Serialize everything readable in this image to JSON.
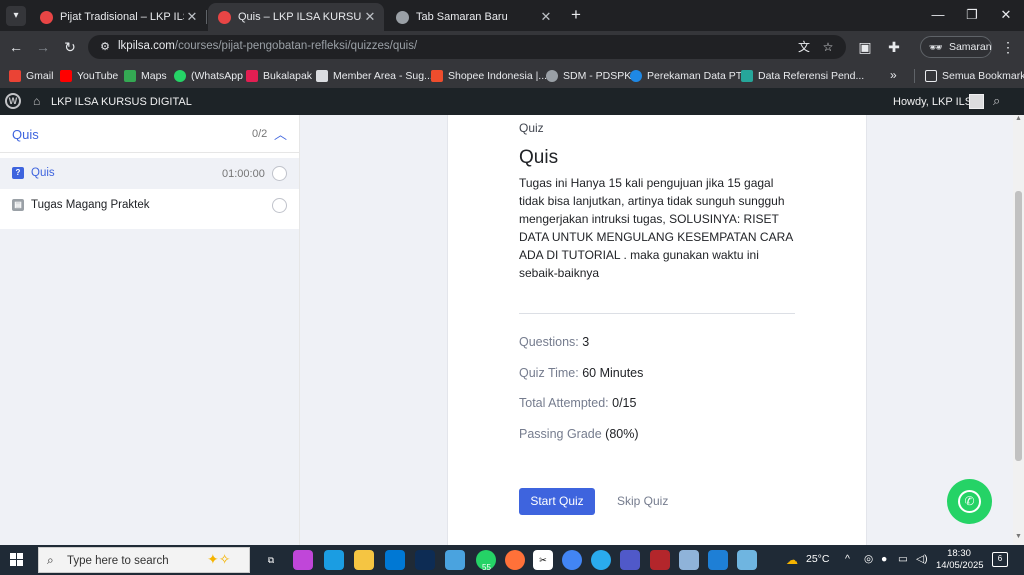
{
  "browser": {
    "tabs": [
      {
        "title": "Pijat Tradisional – LKP ILSA KURSUS",
        "favicon_color": "#e84545",
        "active": false
      },
      {
        "title": "Quis – LKP ILSA KURSUS DIGITAL",
        "favicon_color": "#e84545",
        "active": true
      },
      {
        "title": "Tab Samaran Baru",
        "favicon_color": "#9aa0a6",
        "active": false
      }
    ],
    "url_host": "lkpilsa.com",
    "url_path": "/courses/pijat-pengobatan-refleksi/quizzes/quis/",
    "profile_label": "Samaran",
    "bookmarks": [
      {
        "label": "Gmail",
        "icon": "gmail-icon",
        "color": "#ea4335"
      },
      {
        "label": "YouTube",
        "icon": "youtube-icon",
        "color": "#ff0000"
      },
      {
        "label": "Maps",
        "icon": "maps-icon",
        "color": "#34a853"
      },
      {
        "label": "(WhatsApp",
        "icon": "whatsapp-icon",
        "color": "#25d366"
      },
      {
        "label": "Bukalapak",
        "icon": "bukalapak-icon",
        "color": "#e31e52"
      },
      {
        "label": "Member Area - Sug...",
        "icon": "member-area-icon",
        "color": "#dadce0"
      },
      {
        "label": "Shopee Indonesia |...",
        "icon": "shopee-icon",
        "color": "#ee4d2d"
      },
      {
        "label": "SDM - PDSPK",
        "icon": "globe-icon",
        "color": "#9aa0a6"
      },
      {
        "label": "Perekaman Data PTK",
        "icon": "ptk-icon",
        "color": "#1e88e5"
      },
      {
        "label": "Data Referensi Pend...",
        "icon": "data-ref-icon",
        "color": "#26a69a"
      }
    ],
    "all_bookmarks_label": "Semua Bookmark"
  },
  "wpbar": {
    "site_name": "LKP ILSA KURSUS DIGITAL",
    "howdy": "Howdy, LKP ILSA"
  },
  "sidebar": {
    "section_title": "Quis",
    "progress": "0/2",
    "items": [
      {
        "label": "Quis",
        "time": "01:00:00",
        "active": true,
        "icon": "quiz-icon"
      },
      {
        "label": "Tugas Magang Praktek",
        "time": "",
        "active": false,
        "icon": "assignment-icon"
      }
    ]
  },
  "quiz": {
    "crumb": "Quiz",
    "title": "Quis",
    "description": "Tugas ini Hanya 15 kali pengujuan jika 15 gagal tidak bisa lanjutkan, artinya tidak sunguh sungguh mengerjakan intruksi tugas, SOLUSINYA: RISET DATA UNTUK MENGULANG KESEMPATAN CARA ADA DI TUTORIAL . maka gunakan waktu ini sebaik-baiknya",
    "info": [
      {
        "label": "Questions:",
        "value": "3"
      },
      {
        "label": "Quiz Time:",
        "value": "60 Minutes"
      },
      {
        "label": "Total Attempted:",
        "value": "0/15"
      },
      {
        "label": "Passing Grade",
        "value": "(80%)"
      }
    ],
    "start_label": "Start Quiz",
    "skip_label": "Skip Quiz"
  },
  "taskbar": {
    "search_placeholder": "Type here to search",
    "whatsapp_badge": "55",
    "temperature": "25°C",
    "time": "18:30",
    "date": "14/05/2025",
    "notification_count": "6"
  },
  "colors": {
    "accent": "#3e64de",
    "whatsapp": "#25d366"
  }
}
